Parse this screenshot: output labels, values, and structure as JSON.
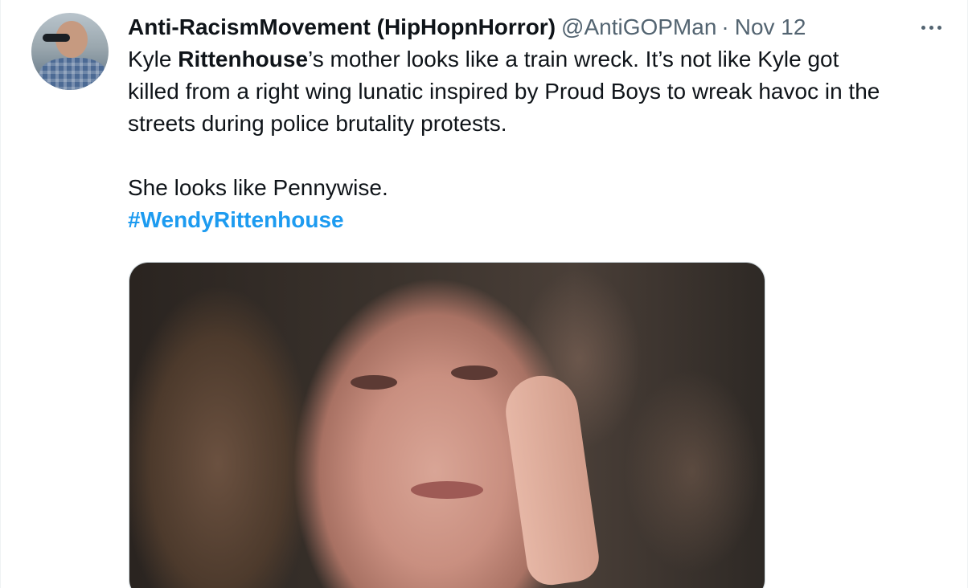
{
  "tweet": {
    "display_name": "Anti-RacismMovement (HipHopnHorror)",
    "handle": "@AntiGOPMan",
    "separator": "·",
    "date": "Nov 12",
    "text_line1_a": "Kyle ",
    "text_line1_bold": "Rittenhouse",
    "text_line1_b": "’s mother looks like a train wreck. It’s not like Kyle got",
    "text_line2": "killed from a right wing lunatic inspired by Proud Boys to wreak havoc in the",
    "text_line3": "streets during police brutality protests.",
    "text_line4": "She looks like Pennywise.",
    "hashtag": "#WendyRittenhouse"
  },
  "icons": {
    "more": "more-horizontal-icon"
  },
  "colors": {
    "text": "#0f1419",
    "secondary": "#536471",
    "link": "#1d9bf0",
    "border": "#cfd9de"
  }
}
